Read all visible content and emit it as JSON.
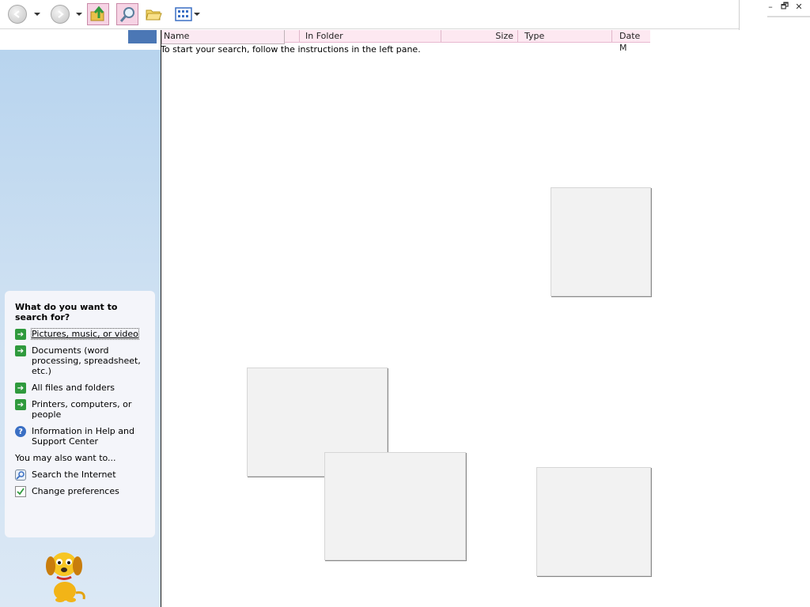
{
  "window": {
    "controls": {
      "minimize": "–",
      "restore": "🗗",
      "close": "✕"
    }
  },
  "toolbar": {
    "icons": [
      "back-icon",
      "forward-icon",
      "up-folder-icon",
      "search-icon",
      "folders-icon",
      "views-icon"
    ]
  },
  "list": {
    "columns": {
      "name": "Name",
      "in_folder": "In Folder",
      "size": "Size",
      "type": "Type",
      "date": "Date M"
    },
    "hint": "To start your search, follow the instructions in the left pane."
  },
  "search_pane": {
    "title": "What do you want to search for?",
    "options": [
      {
        "label": "Pictures, music, or video",
        "icon": "green-arrow-icon"
      },
      {
        "label": "Documents (word processing, spreadsheet, etc.)",
        "icon": "green-arrow-icon"
      },
      {
        "label": "All files and folders",
        "icon": "green-arrow-icon"
      },
      {
        "label": "Printers, computers, or people",
        "icon": "green-arrow-icon"
      },
      {
        "label": "Information in Help and Support Center",
        "icon": "help-icon"
      }
    ],
    "also_label": "You may also want to...",
    "also": [
      {
        "label": "Search the Internet",
        "icon": "internet-search-icon"
      },
      {
        "label": "Change preferences",
        "icon": "preferences-icon"
      }
    ]
  },
  "colors": {
    "header_bg": "#fde8f1",
    "pane_gradient_top": "#b6d3ee",
    "selected_block": "#4b77b5",
    "arrow_green": "#2f9a3d"
  }
}
